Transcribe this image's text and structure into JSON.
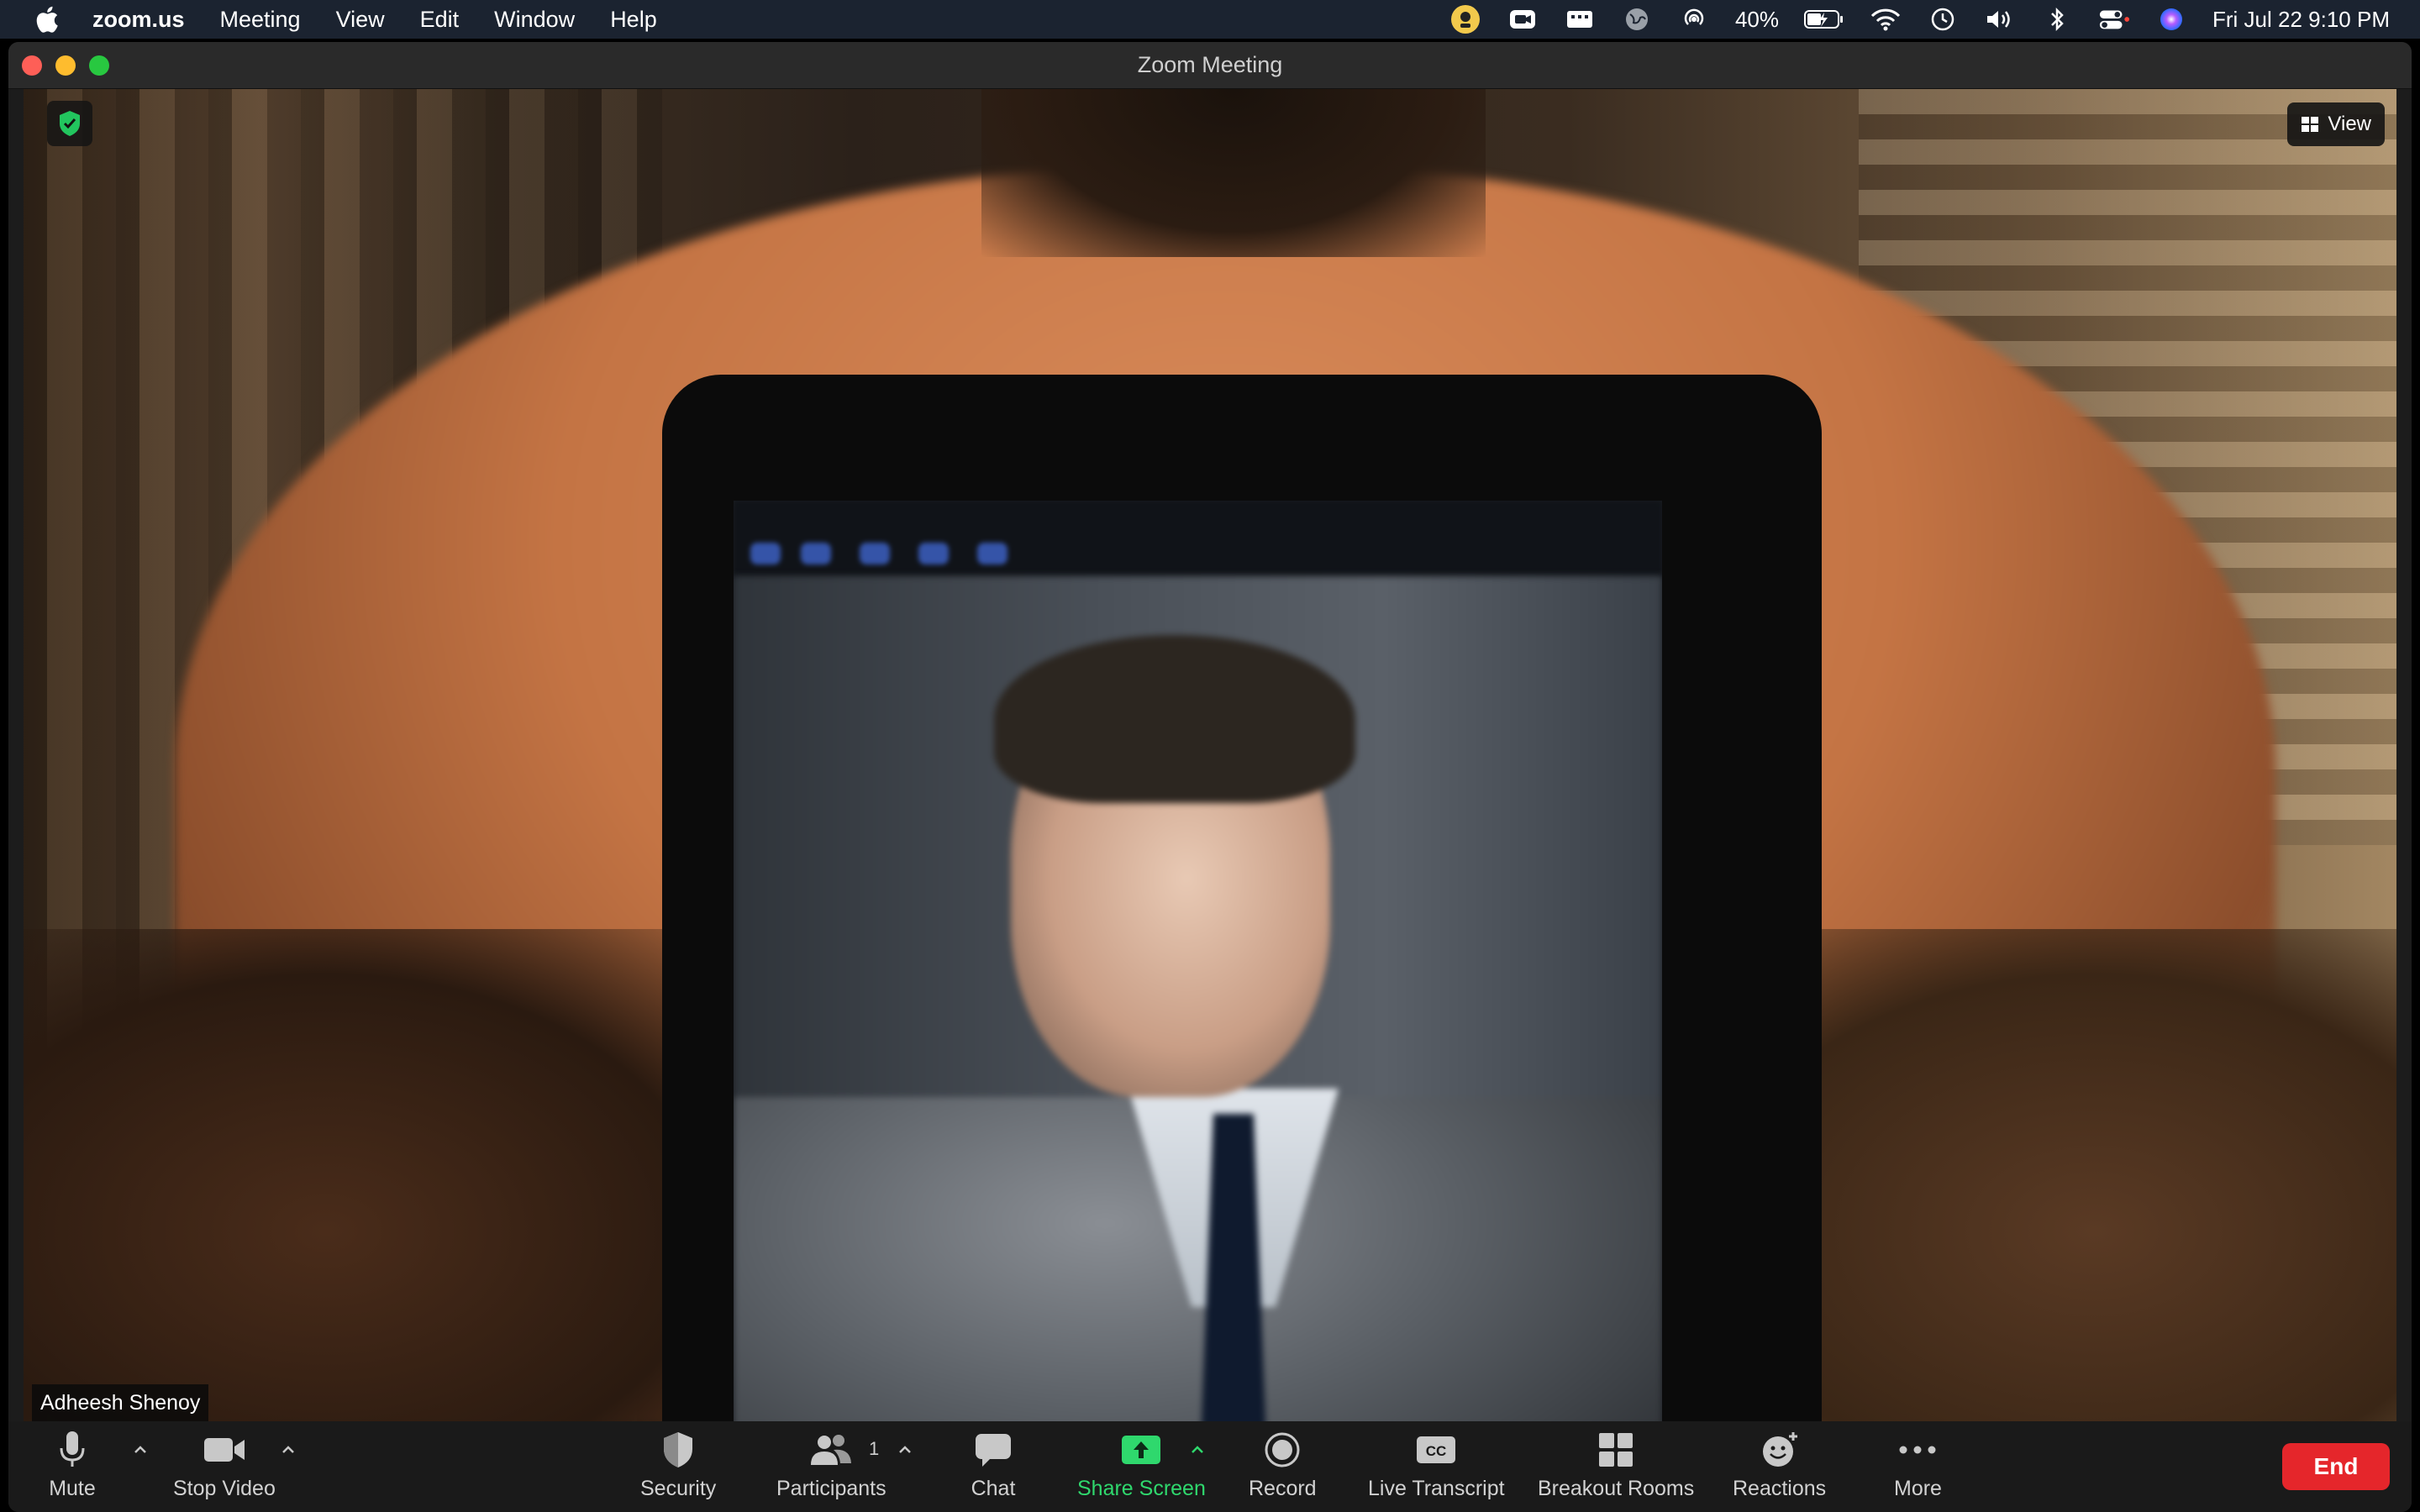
{
  "menubar": {
    "app_name": "zoom.us",
    "items": [
      "Meeting",
      "View",
      "Edit",
      "Window",
      "Help"
    ],
    "battery": "40%",
    "datetime": "Fri Jul 22  9:10 PM",
    "status_icons": [
      "zoom-app-icon",
      "video-camera-icon",
      "keyboard-brightness-icon",
      "globe-icon",
      "airdrop-icon",
      "battery-icon",
      "wifi-icon",
      "time-machine-icon",
      "volume-icon",
      "bluetooth-icon",
      "control-center-icon",
      "siri-icon"
    ]
  },
  "window": {
    "title": "Zoom Meeting"
  },
  "video": {
    "view_label": "View",
    "participant_name": "Adheesh Shenoy"
  },
  "toolbar": {
    "mute_label": "Mute",
    "stop_video_label": "Stop Video",
    "security_label": "Security",
    "participants_label": "Participants",
    "participants_count": "1",
    "chat_label": "Chat",
    "share_screen_label": "Share Screen",
    "record_label": "Record",
    "live_transcript_label": "Live Transcript",
    "live_transcript_badge": "CC",
    "breakout_rooms_label": "Breakout Rooms",
    "reactions_label": "Reactions",
    "more_label": "More",
    "end_label": "End"
  },
  "colors": {
    "share_accent": "#2fd86d",
    "end_button": "#e5262b",
    "menubar_bg": "#1b2330"
  }
}
